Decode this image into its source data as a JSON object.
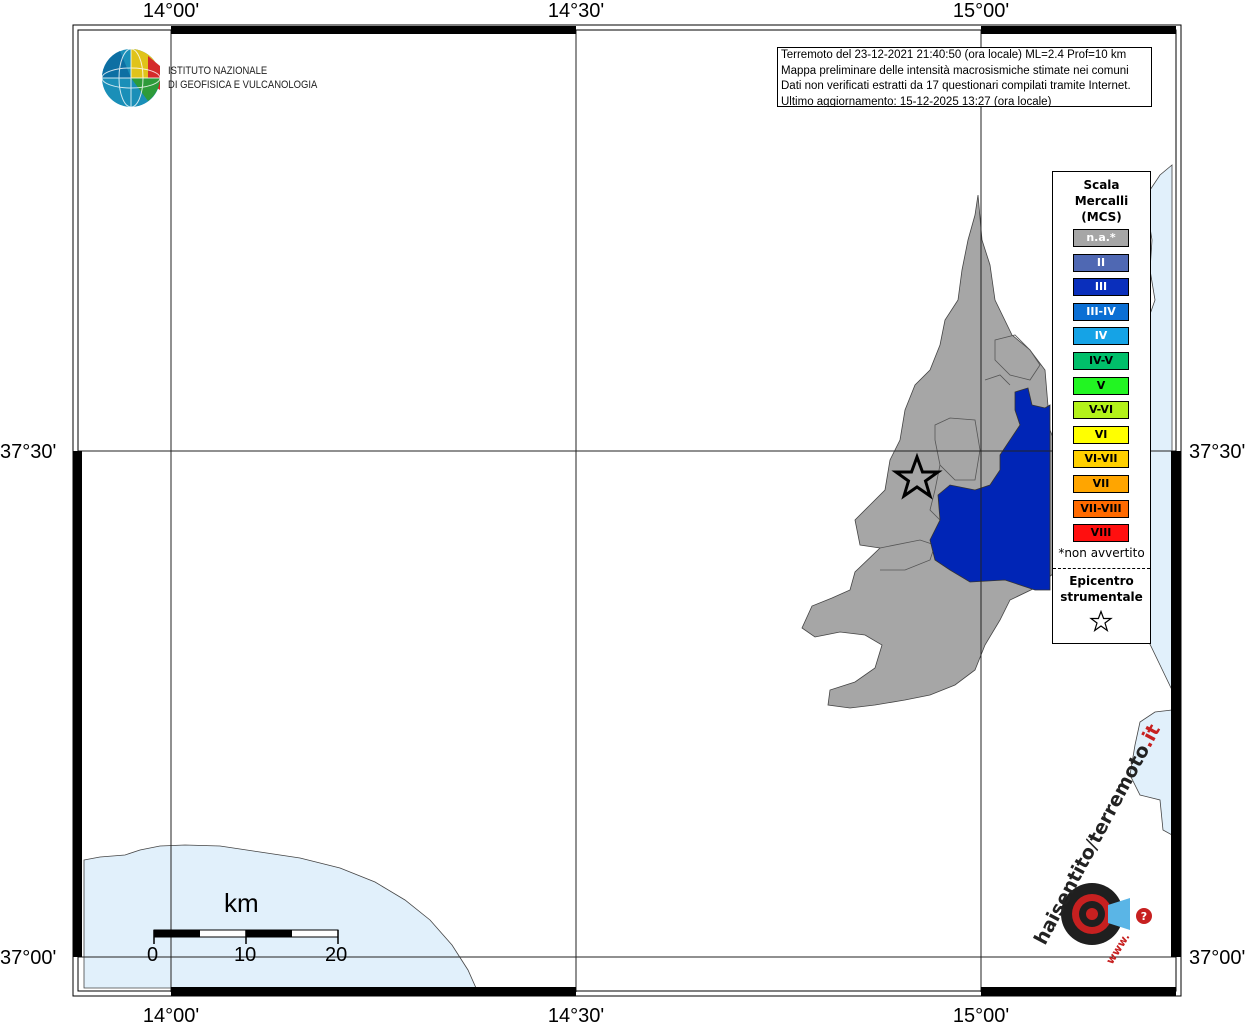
{
  "map": {
    "lon_labels": [
      "14°00'",
      "14°30'",
      "15°00'"
    ],
    "lat_labels": [
      "37°30'",
      "37°00'"
    ],
    "sea_color": "#e1f0fb",
    "land_color": "#a6a6a6",
    "intensity_color": "#0025b6"
  },
  "logo": {
    "name_line1": "ISTITUTO NAZIONALE",
    "name_line2": "DI GEOFISICA E VULCANOLOGIA"
  },
  "info": {
    "line1": "Terremoto del 23-12-2021 21:40:50 (ora locale) ML=2.4 Prof=10 km",
    "line2": "Mappa preliminare delle intensità macrosismiche stimate nei comuni",
    "line3": "Dati non verificati estratti da 17 questionari compilati tramite Internet.",
    "line4": "Ultimo aggiornamento: 15-12-2025 13:27 (ora locale)"
  },
  "legend": {
    "title1": "Scala",
    "title2": "Mercalli",
    "title3": "(MCS)",
    "items": [
      {
        "label": "n.a.*",
        "color": "#a6a6a6",
        "text_color": "#ffffff"
      },
      {
        "label": "II",
        "color": "#4f68b3",
        "text_color": "#ffffff"
      },
      {
        "label": "III",
        "color": "#0a2fbc",
        "text_color": "#ffffff"
      },
      {
        "label": "III-IV",
        "color": "#0b6fd4",
        "text_color": "#ffffff"
      },
      {
        "label": "IV",
        "color": "#15a3e6",
        "text_color": "#ffffff"
      },
      {
        "label": "IV-V",
        "color": "#00bf6a",
        "text_color": "#000000"
      },
      {
        "label": "V",
        "color": "#22f522",
        "text_color": "#000000"
      },
      {
        "label": "V-VI",
        "color": "#b3f21a",
        "text_color": "#000000"
      },
      {
        "label": "VI",
        "color": "#ffff00",
        "text_color": "#000000"
      },
      {
        "label": "VI-VII",
        "color": "#ffd000",
        "text_color": "#000000"
      },
      {
        "label": "VII",
        "color": "#ffa500",
        "text_color": "#000000"
      },
      {
        "label": "VII-VIII",
        "color": "#ff6a00",
        "text_color": "#000000"
      },
      {
        "label": "VIII",
        "color": "#ff0f0f",
        "text_color": "#000000"
      }
    ],
    "note": "*non avvertito",
    "epi1": "Epicentro",
    "epi2": "strumentale"
  },
  "scalebar": {
    "unit": "km",
    "labels": [
      "0",
      "10",
      "20"
    ]
  },
  "hsit": {
    "text1": "haisentito",
    "text2": "terremoto",
    "text3": ".it",
    "www": "www."
  }
}
